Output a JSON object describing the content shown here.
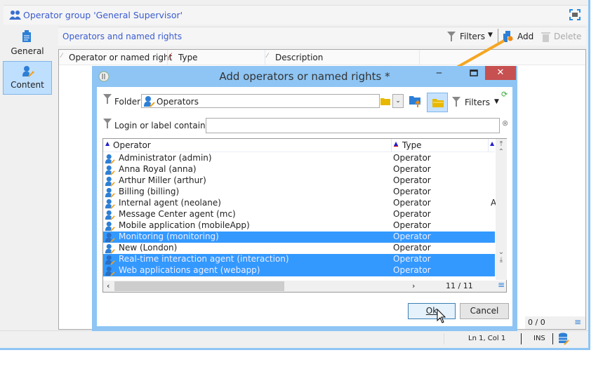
{
  "window": {
    "title": "Operator group 'General Supervisor'"
  },
  "nav": [
    {
      "label": "General",
      "icon": "clipboard-icon"
    },
    {
      "label": "Content",
      "icon": "operator-key-icon",
      "active": true
    }
  ],
  "section": {
    "title": "Operators and named rights",
    "filters_label": "Filters",
    "add_label": "Add",
    "delete_label": "Delete"
  },
  "grid": {
    "columns": [
      "Operator or named right",
      "Type",
      "Description"
    ],
    "count": "0 / 0"
  },
  "dialog": {
    "title": "Add operators or named rights *",
    "folder_label": "Folder:",
    "folder_value": "Operators",
    "filters_label": "Filters",
    "search_label": "Login or label contains:",
    "search_value": "",
    "columns": [
      "Operator",
      "Type"
    ],
    "rows": [
      {
        "name": "Administrator (admin)",
        "type": "Operator",
        "selected": false,
        "extra": ""
      },
      {
        "name": "Anna Royal (anna)",
        "type": "Operator",
        "selected": false,
        "extra": ""
      },
      {
        "name": "Arthur Miller (arthur)",
        "type": "Operator",
        "selected": false,
        "extra": ""
      },
      {
        "name": "Billing (billing)",
        "type": "Operator",
        "selected": false,
        "extra": ""
      },
      {
        "name": "Internal agent (neolane)",
        "type": "Operator",
        "selected": false,
        "extra": "A"
      },
      {
        "name": "Message Center agent (mc)",
        "type": "Operator",
        "selected": false,
        "extra": ""
      },
      {
        "name": "Mobile application (mobileApp)",
        "type": "Operator",
        "selected": false,
        "extra": ""
      },
      {
        "name": "Monitoring (monitoring)",
        "type": "Operator",
        "selected": true,
        "extra": ""
      },
      {
        "name": "New (London)",
        "type": "Operator",
        "selected": false,
        "extra": ""
      },
      {
        "name": "Real-time interaction agent (interaction)",
        "type": "Operator",
        "selected": true,
        "extra": ""
      },
      {
        "name": "Web applications agent (webapp)",
        "type": "Operator",
        "selected": true,
        "extra": ""
      }
    ],
    "count": "11 / 11",
    "ok_label": "Ok",
    "cancel_label": "Cancel"
  },
  "status": {
    "position": "Ln 1, Col 1",
    "mode": "INS"
  },
  "colors": {
    "accent": "#8ec5f4",
    "selection": "#3399ff",
    "close": "#c75050",
    "arrow": "#f5a623"
  }
}
